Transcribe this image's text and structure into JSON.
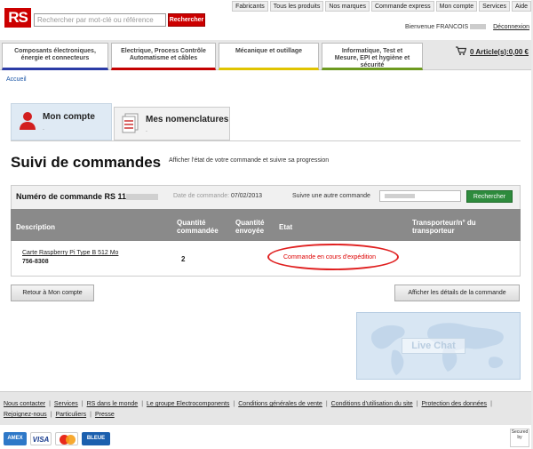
{
  "header": {
    "logo_text": "RS",
    "search_placeholder": "Rechercher par mot-clé ou référence",
    "search_button": "Rechercher",
    "top_links": [
      "Fabricants",
      "Tous les produits",
      "Nos marques",
      "Commande express",
      "Mon compte",
      "Services",
      "Aide"
    ],
    "welcome_label": "Bienvenue",
    "user_name": "FRANCOIS",
    "logout_label": "Déconnexion"
  },
  "categories": [
    {
      "line1": "Composants électroniques,",
      "line2": "énergie et connecteurs"
    },
    {
      "line1": "Electrique, Process Contrôle",
      "line2": "Automatisme et câbles"
    },
    {
      "line1": "Mécanique et outillage",
      "line2": ""
    },
    {
      "line1": "Informatique, Test et",
      "line2": "Mesure, EPI et hygiène et",
      "line3": "sécurité"
    }
  ],
  "cart": {
    "label": "0 Article(s):0,00 €"
  },
  "breadcrumb": "Accueil",
  "tabs": [
    {
      "title": "Mon compte",
      "sub": "."
    },
    {
      "title": "Mes nomenclatures",
      "sub": "."
    }
  ],
  "page": {
    "title": "Suivi de commandes",
    "description": "Afficher l'état de votre commande et suivre sa progression"
  },
  "order": {
    "number_label": "Numéro de commande RS 11",
    "date_label": "Date de commande:",
    "date_value": "07/02/2013",
    "follow_label": "Suivre une autre commande",
    "follow_button": "Rechercher"
  },
  "table": {
    "headers": {
      "description": "Description",
      "qty_line1": "Quantité",
      "qty_line2": "commandée",
      "sent_line1": "Quantité",
      "sent_line2": "envoyée",
      "state": "Etat",
      "carrier_line1": "Transporteur/n° du",
      "carrier_line2": "transporteur"
    },
    "rows": [
      {
        "product": "Carte Raspberry Pi Type B 512 Mo",
        "code": "756-8308",
        "qty": "2",
        "status": "Commande en cours d'expédition"
      }
    ]
  },
  "buttons": {
    "back": "Retour à Mon compte",
    "details": "Afficher les détails de la commande"
  },
  "livechat": {
    "label": "Live Chat"
  },
  "footer": {
    "links": [
      "Nous contacter",
      "Services",
      "RS dans le monde",
      "Le groupe Electrocomponents",
      "Conditions générales de vente",
      "Conditions d'utilisation du site",
      "Protection des données",
      "Rejoignez-nous",
      "Particuliers",
      "Presse"
    ],
    "cards": {
      "amex": "AMEX",
      "visa": "VISA",
      "bleue": "BLEUE"
    },
    "secured": "Secured by"
  },
  "colors": {
    "brand_red": "#cc0000",
    "accent_green": "#2e8b3d",
    "status_red": "#dd0000"
  }
}
